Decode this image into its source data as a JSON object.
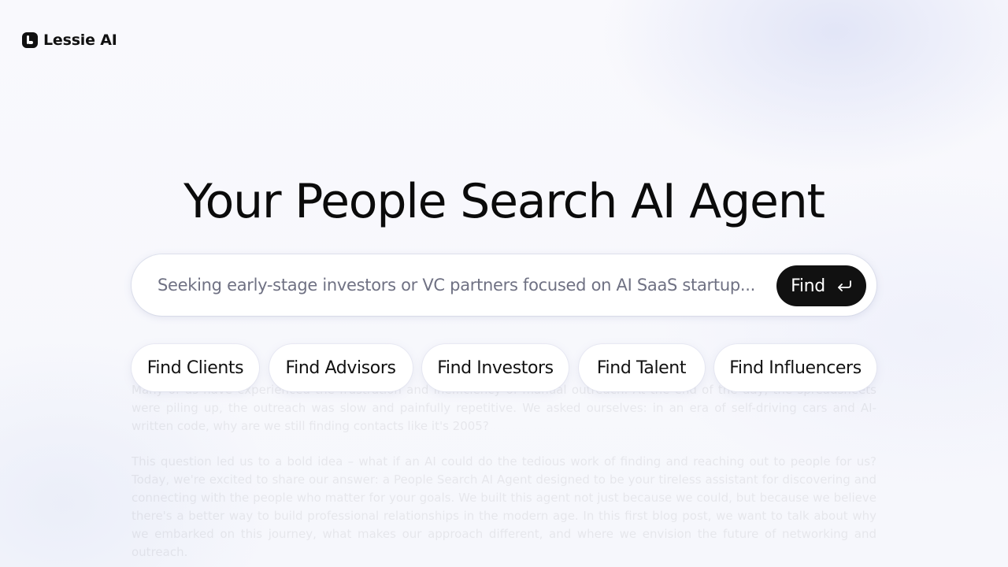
{
  "brand": {
    "name": "Lessie AI",
    "logo_icon": "lessie-logo-icon"
  },
  "hero": {
    "title": "Your People Search AI Agent"
  },
  "search": {
    "value": "Seeking early-stage investors or VC partners focused on AI SaaS startup...",
    "button_label": "Find",
    "button_icon": "enter-return-icon"
  },
  "chips": [
    {
      "label": "Find Clients"
    },
    {
      "label": "Find Advisors"
    },
    {
      "label": "Find Investors"
    },
    {
      "label": "Find Talent"
    },
    {
      "label": "Find Influencers"
    }
  ],
  "colors": {
    "primary_dark": "#111111",
    "placeholder_text": "#6f7183",
    "background": "#f7f8fc"
  }
}
